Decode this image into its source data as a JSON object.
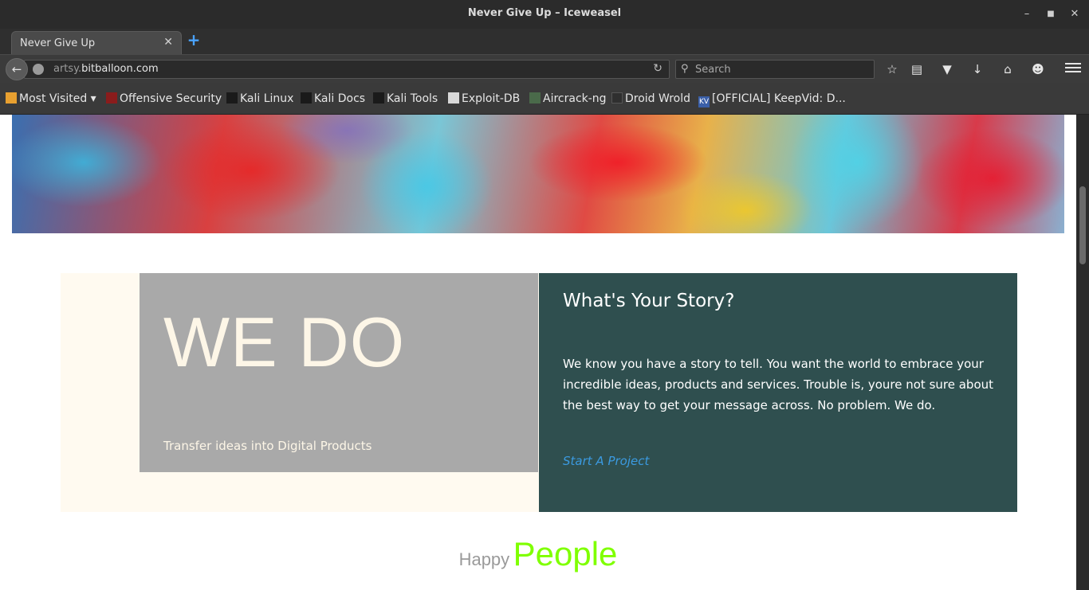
{
  "window": {
    "title": "Never Give Up – Iceweasel"
  },
  "tabs": [
    {
      "label": "Never Give Up"
    }
  ],
  "navbar": {
    "url_prefix": "artsy.",
    "url_domain": "bitballoon.com",
    "search_placeholder": "Search"
  },
  "bookmarks": [
    {
      "label": "Most Visited ▾"
    },
    {
      "label": "Offensive Security"
    },
    {
      "label": "Kali Linux"
    },
    {
      "label": "Kali Docs"
    },
    {
      "label": "Kali Tools"
    },
    {
      "label": "Exploit-DB"
    },
    {
      "label": "Aircrack-ng"
    },
    {
      "label": "Droid Wrold"
    },
    {
      "label": "[OFFICIAL] KeepVid: D..."
    }
  ],
  "hero": {
    "heading": "WE DO",
    "subheading": "Transfer ideas into Digital Products"
  },
  "story": {
    "title": "What's Your Story?",
    "body": "We know you have a story to tell. You want the world to embrace your incredible ideas, products and services. Trouble is, youre not sure about the best way to get your message across. No problem. We do.",
    "link": "Start A Project"
  },
  "happy": {
    "word1": "Happy",
    "word2": "People"
  },
  "colors": {
    "grey_box": "#a9a9a9",
    "teal_box": "#2f4f4f",
    "cream_bg": "#fffaf0",
    "link": "#3b9ae0",
    "people": "#7fff00"
  }
}
